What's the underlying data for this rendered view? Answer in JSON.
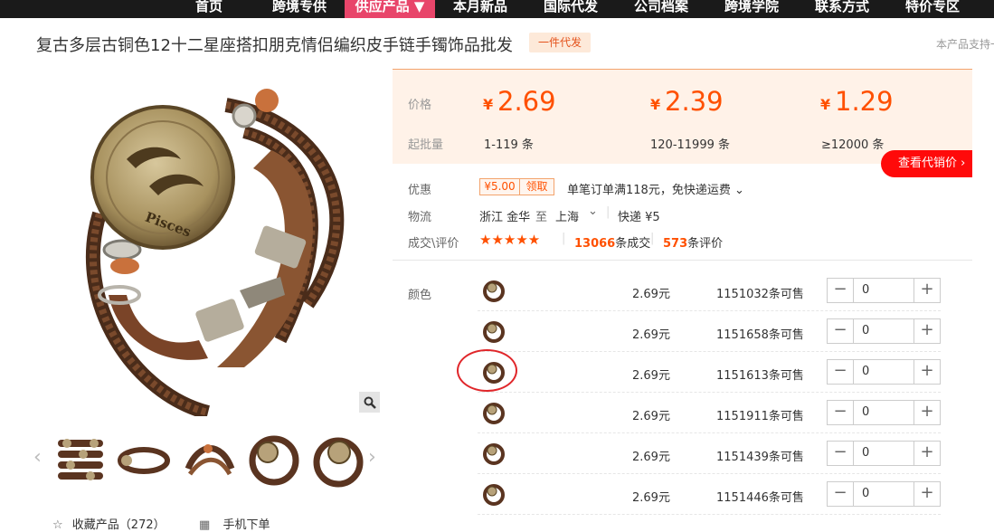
{
  "nav": {
    "items": [
      "首页",
      "跨境专供",
      "供应产品 ▼",
      "本月新品",
      "国际代发",
      "公司档案",
      "跨境学院",
      "联系方式",
      "特价专区"
    ]
  },
  "product": {
    "title": "复古多层古铜色12十二星座搭扣朋克情侣编织皮手链手镯饰品批发",
    "badge": "一件代发",
    "note": "本产品支持一"
  },
  "gallery": {
    "engraving": "Pisces",
    "prev": "‹",
    "next": "›"
  },
  "actions": {
    "favorite": "收藏产品（272）",
    "mobile": "手机下单"
  },
  "pricing": {
    "price_label": "价格",
    "moq_label": "起批量",
    "currency": "¥",
    "tiers": [
      {
        "price": "2.69",
        "range": "1-119 条"
      },
      {
        "price": "2.39",
        "range": "120-11999 条"
      },
      {
        "price": "1.29",
        "range": "≥12000 条"
      }
    ],
    "dist_button": "查看代销价 ›"
  },
  "info": {
    "promo_label": "优惠",
    "coupon_value": "¥5.00",
    "coupon_action": "领取",
    "promo_text": "单笔订单满118元，免快递运费 ⌄",
    "logistics_label": "物流",
    "origin": "浙江 金华",
    "to": "至",
    "dest": "上海",
    "dest_caret": "⌄",
    "shipping": "快递 ¥5",
    "deals_label": "成交\\评价",
    "stars": "★★★★★",
    "deals_count": "13066",
    "deals_suffix": "条成交",
    "reviews_count": "573",
    "reviews_suffix": "条评价"
  },
  "sku": {
    "label": "颜色",
    "rows": [
      {
        "price": "2.69元",
        "stock": "1151032条可售",
        "qty": "0"
      },
      {
        "price": "2.69元",
        "stock": "1151658条可售",
        "qty": "0"
      },
      {
        "price": "2.69元",
        "stock": "1151613条可售",
        "qty": "0"
      },
      {
        "price": "2.69元",
        "stock": "1151911条可售",
        "qty": "0"
      },
      {
        "price": "2.69元",
        "stock": "1151439条可售",
        "qty": "0"
      },
      {
        "price": "2.69元",
        "stock": "1151446条可售",
        "qty": "0"
      }
    ],
    "minus": "−",
    "plus": "+"
  },
  "colors": {
    "accent": "#ff5000",
    "nav_active": "#e8456a",
    "nav_bg": "#1a1a1a",
    "button_red": "#ff0a0a",
    "leather": "#5a3420",
    "bronze": "#b7a27a"
  }
}
